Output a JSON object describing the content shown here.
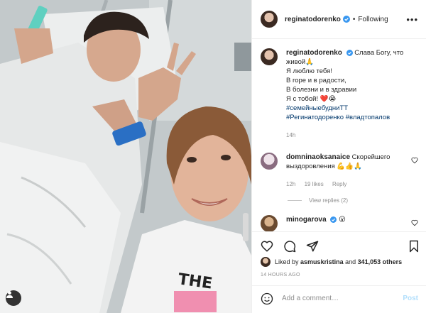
{
  "colors": {
    "link": "#00376b",
    "verified": "#3897f0",
    "muted": "#8e8e8e",
    "post_disabled": "#b2dffc",
    "heart_red": "#ed4956"
  },
  "post": {
    "author": "reginatodorenko",
    "follow_separator": "•",
    "follow_label": "Following",
    "caption": {
      "username": "reginatodorenko",
      "lines": [
        "Слава Богу, что живой🙏",
        "Я люблю тебя!",
        "В горе и в радости,",
        "В болезни и в здравии",
        "Я с тобой! ❤️😭"
      ],
      "hashtags": [
        "#семейныебудниТТ",
        "#Регинатодоренко #владтопалов"
      ],
      "time": "14h"
    },
    "comments": [
      {
        "username": "domninaoksanaice",
        "text": "Скорейшего выздоровления 💪👍🙏",
        "time": "12h",
        "likes": "19 likes",
        "reply_label": "Reply",
        "view_replies": "View replies (2)"
      },
      {
        "username": "minogarova",
        "text": "😮",
        "time": "",
        "likes": "",
        "reply_label": ""
      }
    ],
    "liked_by": {
      "prefix": "Liked by",
      "user": "asmuskristina",
      "and": "and",
      "count": "341,053 others"
    },
    "timestamp": "14 HOURS AGO",
    "add_comment_placeholder": "Add a comment…",
    "post_label": "Post"
  },
  "icons": [
    "user-tag-icon",
    "verified-icon",
    "more-options-icon",
    "heart-icon",
    "comment-icon",
    "share-icon",
    "save-icon",
    "emoji-icon"
  ]
}
